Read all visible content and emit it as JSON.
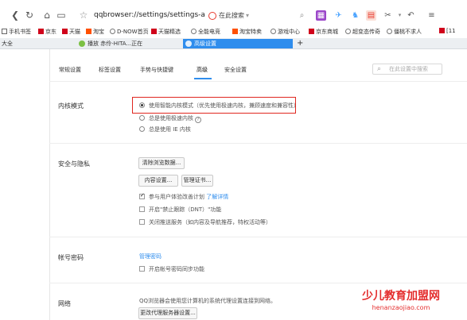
{
  "address_bar": {
    "url": "qqbrowser://settings/settings-a",
    "search_placeholder": "在此搜索"
  },
  "bookmarks": [
    {
      "label": "手机书签",
      "icon": "phone-icon"
    },
    {
      "label": "京东",
      "icon": "jd-icon"
    },
    {
      "label": "天猫",
      "icon": "tmall-icon"
    },
    {
      "label": "淘宝",
      "icon": "taobao-icon"
    },
    {
      "label": "D-NOW首页",
      "icon": "globe-icon"
    },
    {
      "label": "全能电竞",
      "icon": "globe-icon"
    },
    {
      "label": "淘宝特卖",
      "icon": "taobao-icon"
    },
    {
      "label": "游戏中心",
      "icon": "globe-icon"
    },
    {
      "label": "京东商城",
      "icon": "jd-icon"
    },
    {
      "label": "超变态传奇",
      "icon": "globe-icon"
    },
    {
      "label": "僵桃不求人",
      "icon": "globe-icon"
    },
    {
      "label": "[11",
      "icon": "jd-icon"
    }
  ],
  "bookmark_extra": "天猫精选",
  "tabs": [
    {
      "label": "大全"
    },
    {
      "label": "播放 赤伶-HITA...正在"
    },
    {
      "label": "高级设置"
    }
  ],
  "new_tab_label": "+",
  "settings_tabs": [
    "常规设置",
    "标签设置",
    "手势与快捷键",
    "高级",
    "安全设置"
  ],
  "settings_search_placeholder": "在此设置中搜索",
  "kernel": {
    "title": "内核模式",
    "options": [
      "使用智能内核模式（优先使用极速内核，兼顾速度和兼容性）",
      "总是使用极速内核",
      "总是使用 IE 内核"
    ],
    "selected_index": 0,
    "help_icon": "?"
  },
  "security": {
    "title": "安全与隐私",
    "clear_button": "清除浏览数据...",
    "content_button": "内容设置...",
    "cert_button": "管理证书...",
    "checkboxes": [
      {
        "label": "参与用户体验改善计划",
        "link": "了解详情",
        "checked": true
      },
      {
        "label": "开启\"禁止跟踪（DNT）\"功能",
        "checked": false
      },
      {
        "label": "关闭推送服务（如内容及导航推荐，特权活动等）",
        "checked": false
      }
    ]
  },
  "account": {
    "title": "帐号密码",
    "manage_link": "管理密码",
    "sync_label": "开启帐号密码同步功能",
    "sync_checked": false
  },
  "network": {
    "title": "网络",
    "description": "QQ浏览器会使用您计算机的系统代理设置连接到网络。",
    "proxy_button": "更改代理服务器设置..."
  },
  "watermark": {
    "cn": "少儿教育加盟网",
    "en": "henanzaojiao.com"
  },
  "colors": {
    "accent": "#2f8ded",
    "highlight_box": "#e0271f",
    "watermark": "#e42d2d"
  }
}
